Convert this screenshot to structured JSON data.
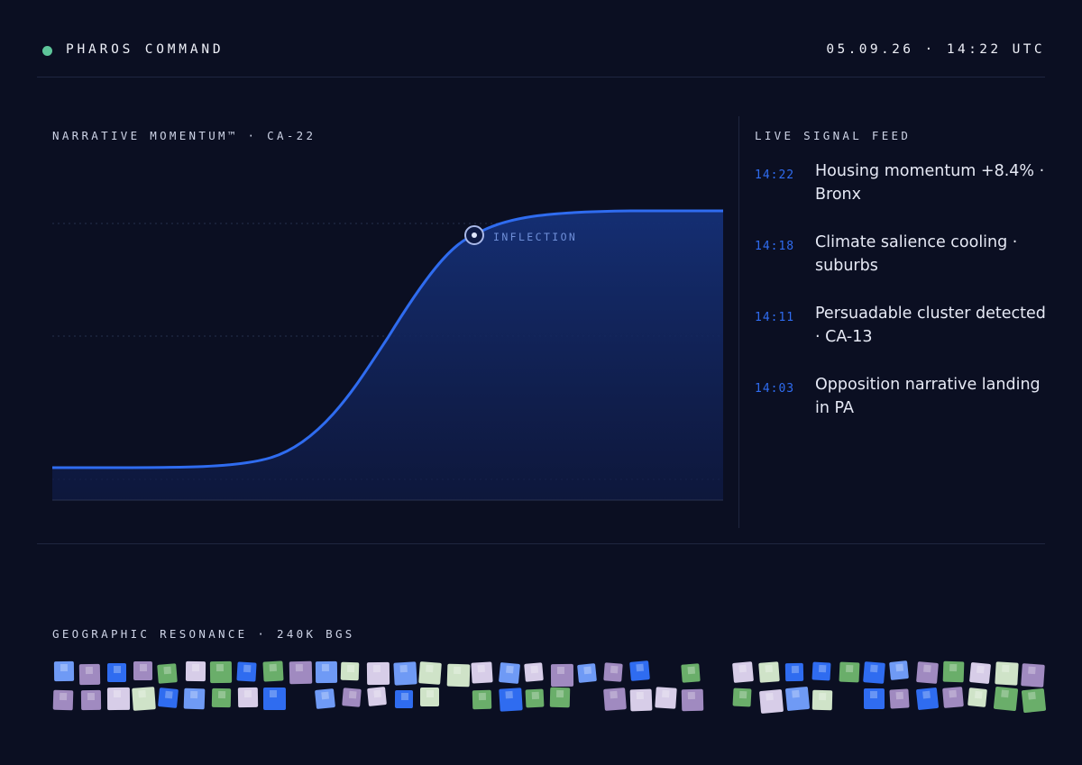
{
  "header": {
    "title": "PHAROS COMMAND",
    "datetime": "05.09.26 · 14:22 UTC",
    "status_color": "#5ec59a"
  },
  "momentum": {
    "title": "NARRATIVE MOMENTUM™ · CA-22",
    "marker_label": "INFLECTION",
    "line_color": "#2f6cf0"
  },
  "feed": {
    "title": "LIVE SIGNAL FEED",
    "items": [
      {
        "time": "14:22",
        "text": "Housing momentum +8.4% · Bronx"
      },
      {
        "time": "14:18",
        "text": "Climate salience cooling · suburbs"
      },
      {
        "time": "14:11",
        "text": "Persuadable cluster detected · CA-13"
      },
      {
        "time": "14:03",
        "text": "Opposition narrative landing in PA"
      }
    ]
  },
  "geo": {
    "title": "GEOGRAPHIC RESONANCE · 240K BGS",
    "palette": [
      "#2f6cf0",
      "#6f9af5",
      "#d7cde8",
      "#a08ac0",
      "#cfe3c8",
      "#6aae6a"
    ]
  }
}
